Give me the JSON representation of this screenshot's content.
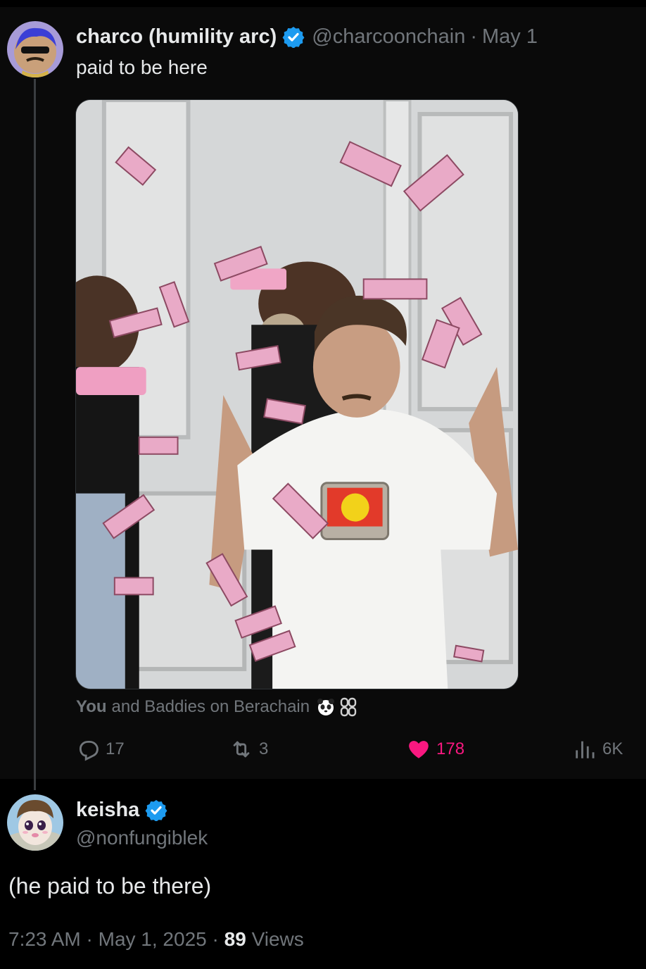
{
  "parent_tweet": {
    "display_name": "charco (humility arc)",
    "handle": "@charcoonchain",
    "separator": "·",
    "date": "May 1",
    "text": "paid to be here",
    "tagged": {
      "you": "You",
      "rest": "and Baddies on Berachain"
    },
    "actions": {
      "replies": "17",
      "reposts": "3",
      "likes": "178",
      "views": "6K"
    }
  },
  "reply_tweet": {
    "display_name": "keisha",
    "handle": "@nonfungiblek",
    "text": "(he paid to be there)",
    "meta": {
      "time": "7:23 AM",
      "sep1": "·",
      "date": "May 1, 2025",
      "sep2": "·",
      "views_count": "89",
      "views_label": "Views"
    }
  },
  "icons": {
    "verified": "verified-badge-icon",
    "reply": "reply-icon",
    "retweet": "retweet-icon",
    "like": "heart-icon",
    "views": "views-chart-icon",
    "panda": "panda-emoji-icon",
    "chain": "chain-emoji-icon"
  },
  "colors": {
    "like": "#f91880",
    "verified": "#1d9bf0",
    "muted": "#71767b",
    "text": "#e7e9ea"
  }
}
